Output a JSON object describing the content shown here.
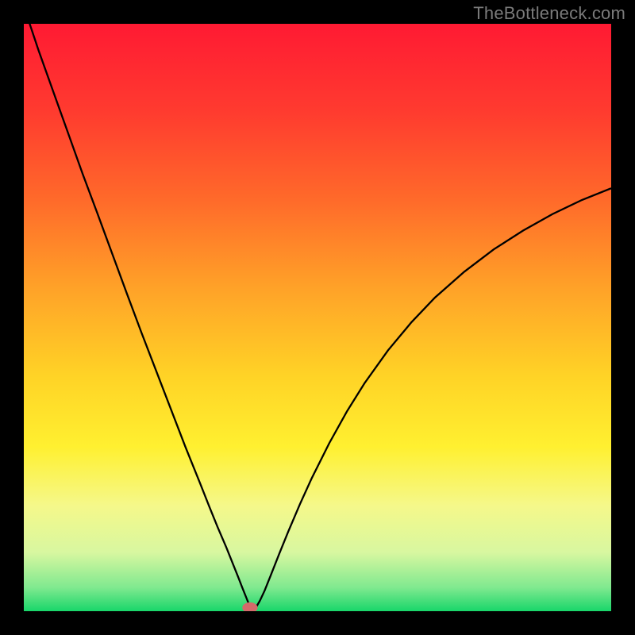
{
  "watermark": "TheBottleneck.com",
  "chart_data": {
    "type": "line",
    "title": "",
    "xlabel": "",
    "ylabel": "",
    "xlim": [
      0,
      100
    ],
    "ylim": [
      0,
      100
    ],
    "background_gradient": {
      "stops": [
        {
          "offset": 0.0,
          "color": "#ff1a33"
        },
        {
          "offset": 0.15,
          "color": "#ff3b2f"
        },
        {
          "offset": 0.3,
          "color": "#ff6a2a"
        },
        {
          "offset": 0.45,
          "color": "#ffa228"
        },
        {
          "offset": 0.6,
          "color": "#ffd326"
        },
        {
          "offset": 0.72,
          "color": "#fff030"
        },
        {
          "offset": 0.82,
          "color": "#f5f88a"
        },
        {
          "offset": 0.9,
          "color": "#d8f7a0"
        },
        {
          "offset": 0.96,
          "color": "#7fe98f"
        },
        {
          "offset": 1.0,
          "color": "#18d66a"
        }
      ]
    },
    "series": [
      {
        "name": "bottleneck-curve",
        "color": "#000000",
        "x": [
          0.0,
          2.5,
          5.0,
          7.5,
          10.0,
          12.5,
          15.0,
          17.5,
          20.0,
          22.5,
          25.0,
          27.5,
          30.0,
          31.5,
          33.0,
          34.5,
          35.5,
          36.5,
          37.2,
          37.8,
          38.2,
          38.6,
          39.0,
          39.5,
          40.2,
          41.0,
          42.0,
          43.5,
          45.0,
          47.0,
          49.0,
          52.0,
          55.0,
          58.0,
          62.0,
          66.0,
          70.0,
          75.0,
          80.0,
          85.0,
          90.0,
          95.0,
          100.0
        ],
        "y": [
          103.0,
          95.5,
          88.5,
          81.5,
          74.5,
          67.8,
          61.0,
          54.2,
          47.5,
          41.0,
          34.5,
          28.0,
          21.8,
          18.0,
          14.3,
          10.8,
          8.3,
          5.8,
          4.0,
          2.5,
          1.5,
          0.8,
          0.3,
          0.6,
          1.8,
          3.5,
          6.0,
          9.8,
          13.5,
          18.2,
          22.6,
          28.6,
          34.0,
          38.8,
          44.4,
          49.2,
          53.4,
          57.8,
          61.6,
          64.8,
          67.6,
          70.0,
          72.0
        ]
      }
    ],
    "markers": [
      {
        "name": "optimum-marker",
        "x": 38.5,
        "y": 0.6,
        "rx": 1.3,
        "ry": 0.9,
        "color": "#d46a6a"
      }
    ]
  }
}
